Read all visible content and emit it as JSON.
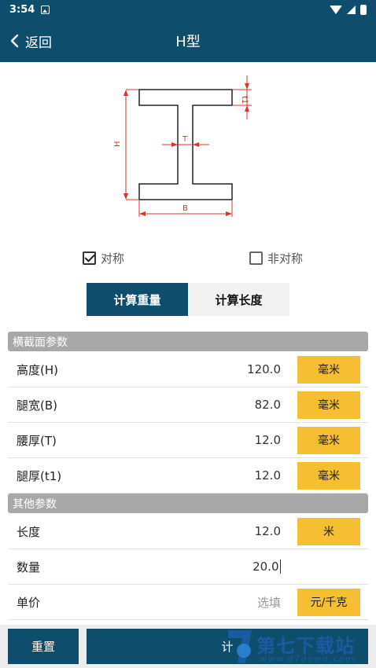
{
  "status_bar": {
    "time": "3:54"
  },
  "header": {
    "back_label": "返回",
    "title": "H型"
  },
  "diagram": {
    "labels": {
      "height": "H",
      "width": "B",
      "web": "T",
      "flange": "t1"
    }
  },
  "symmetry": {
    "symmetric_label": "对称",
    "symmetric_checked": true,
    "asymmetric_label": "非对称",
    "asymmetric_checked": false
  },
  "tabs": {
    "weight_label": "计算重量",
    "length_label": "计算长度",
    "active": "weight"
  },
  "cross_section": {
    "title": "横截面参数",
    "rows": [
      {
        "label": "高度(H)",
        "value": "120.0",
        "unit": "毫米"
      },
      {
        "label": "腿宽(B)",
        "value": "82.0",
        "unit": "毫米"
      },
      {
        "label": "腰厚(T)",
        "value": "12.0",
        "unit": "毫米"
      },
      {
        "label": "腿厚(t1)",
        "value": "12.0",
        "unit": "毫米"
      }
    ]
  },
  "other": {
    "title": "其他参数",
    "rows": [
      {
        "label": "长度",
        "value": "12.0",
        "unit": "米"
      },
      {
        "label": "数量",
        "value": "20.0"
      },
      {
        "label": "单价",
        "placeholder": "选填",
        "unit": "元/千克"
      }
    ]
  },
  "actions": {
    "reset_label": "重置",
    "calc_label": "计"
  },
  "watermark": {
    "title": "第七下载站",
    "subtitle": "www.d7down.com"
  },
  "colors": {
    "primary": "#0e4d6b",
    "unit_button": "#f5be33",
    "section_bg": "#a8a8a8",
    "dimension_lines": "#e0302a"
  }
}
